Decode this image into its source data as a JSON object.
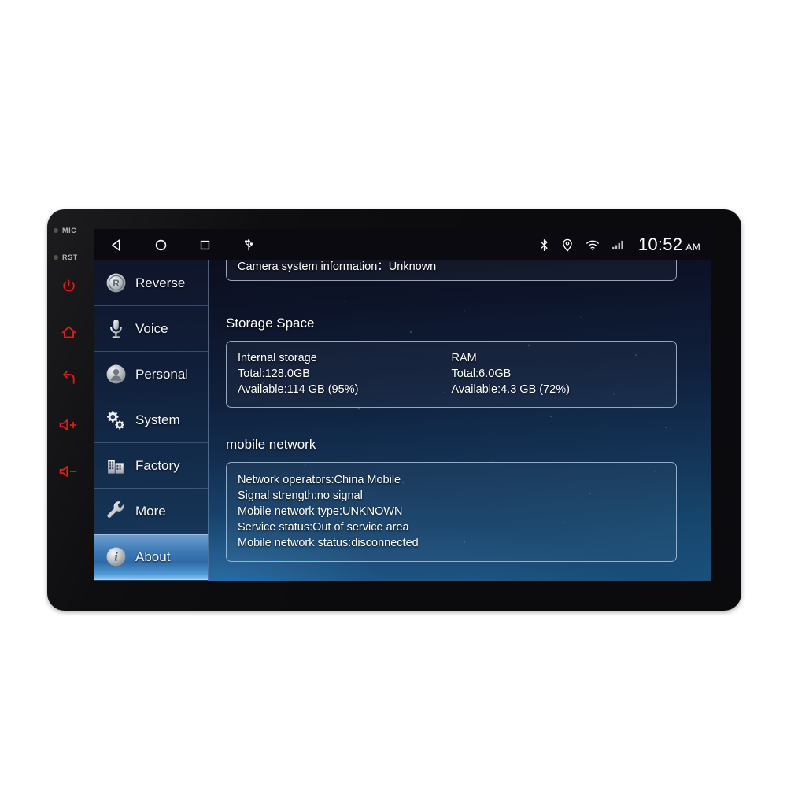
{
  "device": {
    "hardware_labels": [
      {
        "name": "mic-indicator",
        "text": "MIC"
      },
      {
        "name": "reset-indicator",
        "text": "RST"
      }
    ],
    "hardware_buttons": [
      {
        "name": "power-button",
        "icon": "power-icon"
      },
      {
        "name": "home-button",
        "icon": "home-icon"
      },
      {
        "name": "back-button",
        "icon": "back-arrow-icon"
      },
      {
        "name": "volume-up-button",
        "icon": "volume-up-icon"
      },
      {
        "name": "volume-down-button",
        "icon": "volume-down-icon"
      }
    ]
  },
  "statusbar": {
    "nav": [
      {
        "name": "android-back-button",
        "icon": "back-triangle-icon"
      },
      {
        "name": "android-home-button",
        "icon": "home-circle-icon"
      },
      {
        "name": "android-recents-button",
        "icon": "recents-square-icon"
      },
      {
        "name": "usb-status-icon",
        "icon": "usb-icon"
      }
    ],
    "indicators": [
      {
        "name": "bluetooth-icon",
        "icon": "bluetooth-icon"
      },
      {
        "name": "location-icon",
        "icon": "location-pin-icon"
      },
      {
        "name": "wifi-icon",
        "icon": "wifi-icon"
      },
      {
        "name": "cell-signal-icon",
        "icon": "signal-bars-icon"
      }
    ],
    "clock": {
      "time": "10:52",
      "ampm": "AM"
    }
  },
  "sidebar": {
    "items": [
      {
        "label": "Reverse",
        "icon": "reverse-r-icon",
        "active": false
      },
      {
        "label": "Voice",
        "icon": "microphone-icon",
        "active": false
      },
      {
        "label": "Personal",
        "icon": "person-icon",
        "active": false
      },
      {
        "label": "System",
        "icon": "gears-icon",
        "active": false
      },
      {
        "label": "Factory",
        "icon": "building-icon",
        "active": false
      },
      {
        "label": "More",
        "icon": "wrench-icon",
        "active": false
      },
      {
        "label": "About",
        "icon": "info-icon",
        "active": true
      }
    ]
  },
  "content": {
    "camera_card": {
      "line": "Camera system information：Unknown"
    },
    "storage": {
      "title": "Storage Space",
      "internal": {
        "heading": "Internal storage",
        "total": "Total:128.0GB",
        "available": "Available:114 GB (95%)"
      },
      "ram": {
        "heading": "RAM",
        "total": "Total:6.0GB",
        "available": "Available:4.3 GB (72%)"
      }
    },
    "mobile_network": {
      "title": "mobile network",
      "lines": [
        "Network operators:China Mobile",
        "Signal strength:no signal",
        "Mobile network type:UNKNOWN",
        "Service status:Out of service area",
        "Mobile network status:disconnected"
      ]
    }
  },
  "colors": {
    "bezel": "#0b0b0d",
    "hardware_red": "#e01b1b",
    "accent_blue": "#3d7ab5",
    "text_white": "#ffffff",
    "page_background": "#ffffff"
  }
}
